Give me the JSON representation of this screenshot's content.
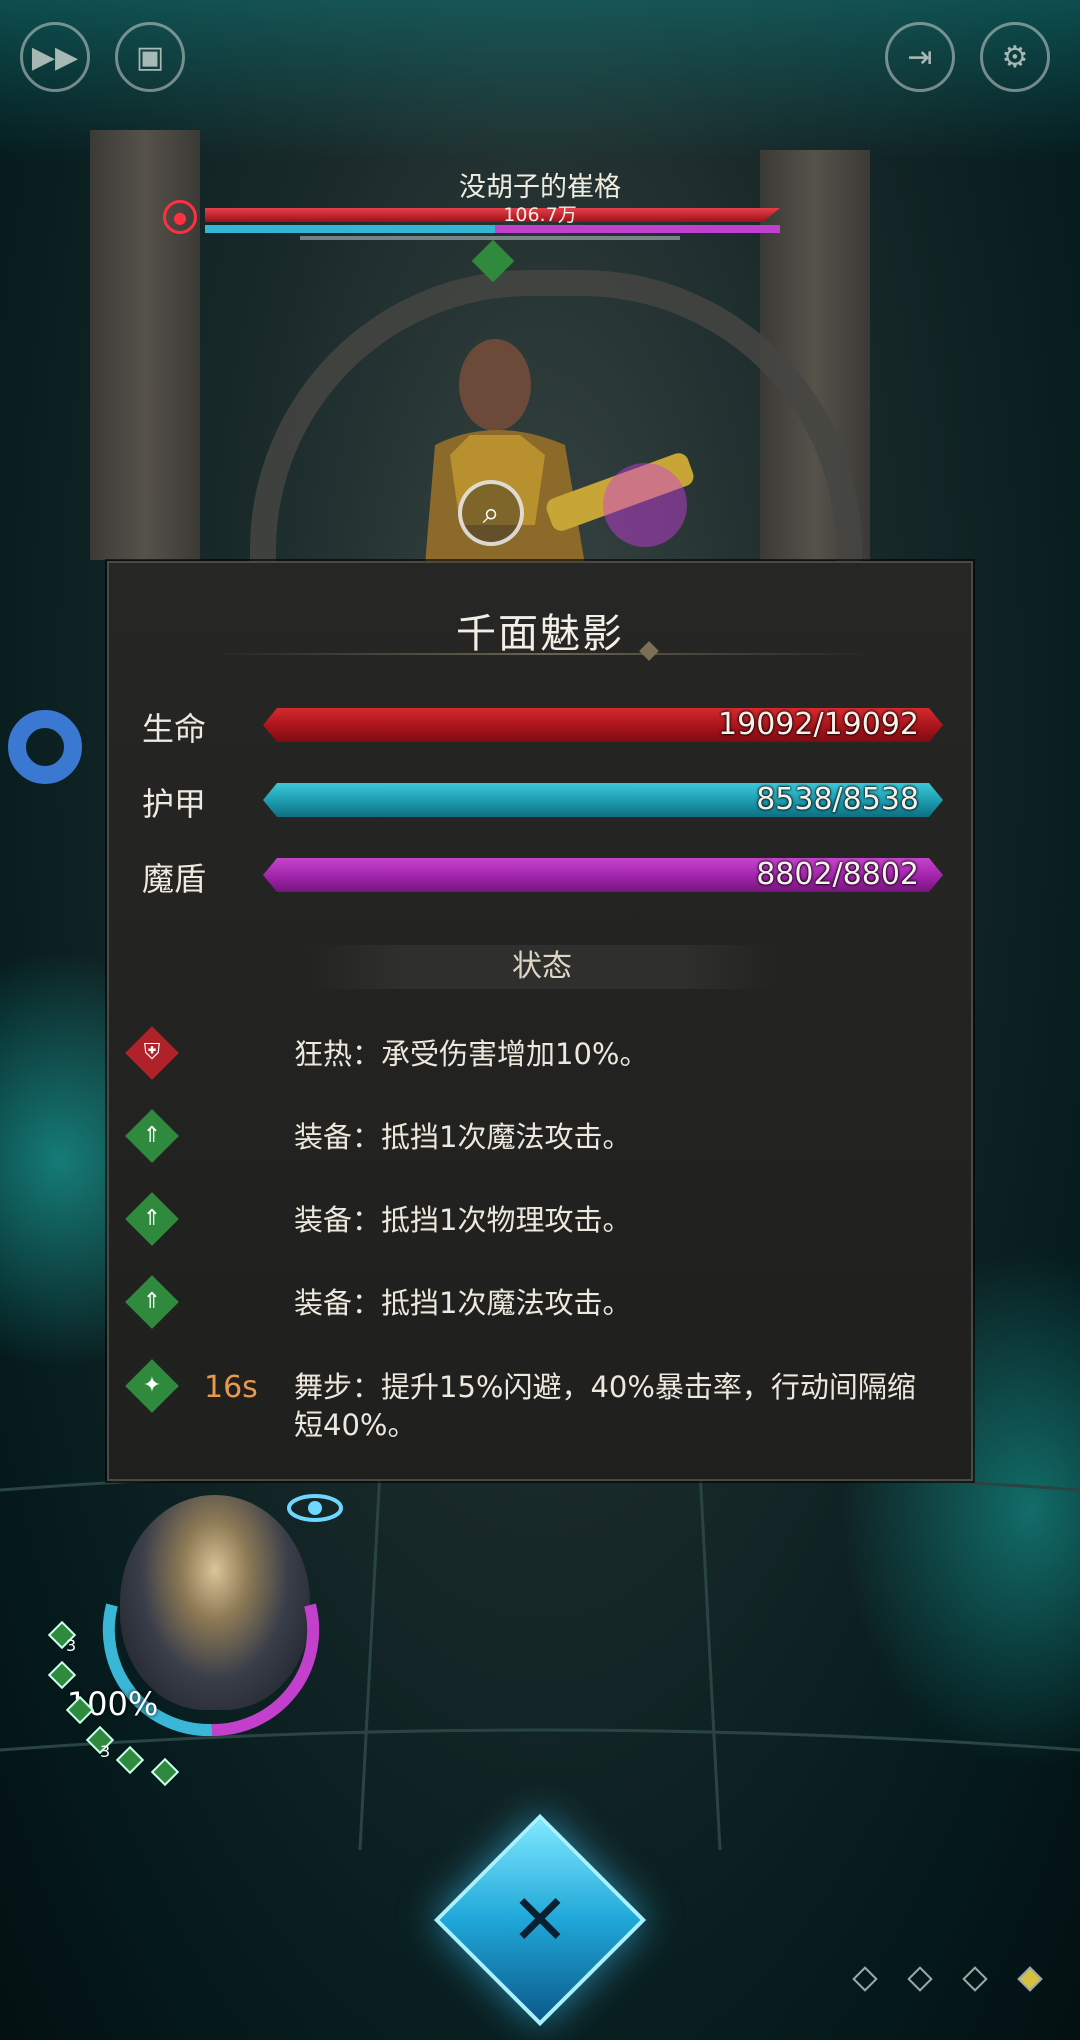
{
  "top_controls": {
    "fast_forward_icon": "fast-forward-icon",
    "auto_icon": "auto-battle-icon",
    "exit_icon": "exit-icon",
    "settings_icon": "gear-icon"
  },
  "boss": {
    "name": "没胡子的崔格",
    "hp_text": "106.7万"
  },
  "panel": {
    "title": "千面魅影",
    "stats": [
      {
        "label": "生命",
        "value": "19092/19092",
        "color": "#c0161e"
      },
      {
        "label": "护甲",
        "value": "8538/8538",
        "color": "#1c9aae"
      },
      {
        "label": "魔盾",
        "value": "8802/8802",
        "color": "#a024aa"
      }
    ],
    "status_header": "状态",
    "statuses": [
      {
        "icon": "shield-icon",
        "color": "#b0222a",
        "time": "",
        "text": "狂热：承受伤害增加10%。"
      },
      {
        "icon": "up-arrow-icon",
        "color": "#2f8a3e",
        "time": "",
        "text": "装备：抵挡1次魔法攻击。"
      },
      {
        "icon": "up-arrow-icon",
        "color": "#2f8a3e",
        "time": "",
        "text": "装备：抵挡1次物理攻击。"
      },
      {
        "icon": "up-arrow-icon",
        "color": "#2f8a3e",
        "time": "",
        "text": "装备：抵挡1次魔法攻击。"
      },
      {
        "icon": "dance-icon",
        "color": "#2f8a3e",
        "time": "16s",
        "text": "舞步：提升15%闪避，40%暴击率，行动间隔缩短40%。"
      }
    ]
  },
  "hero": {
    "percent": "100%",
    "buff_counts": [
      "3",
      "3"
    ]
  }
}
